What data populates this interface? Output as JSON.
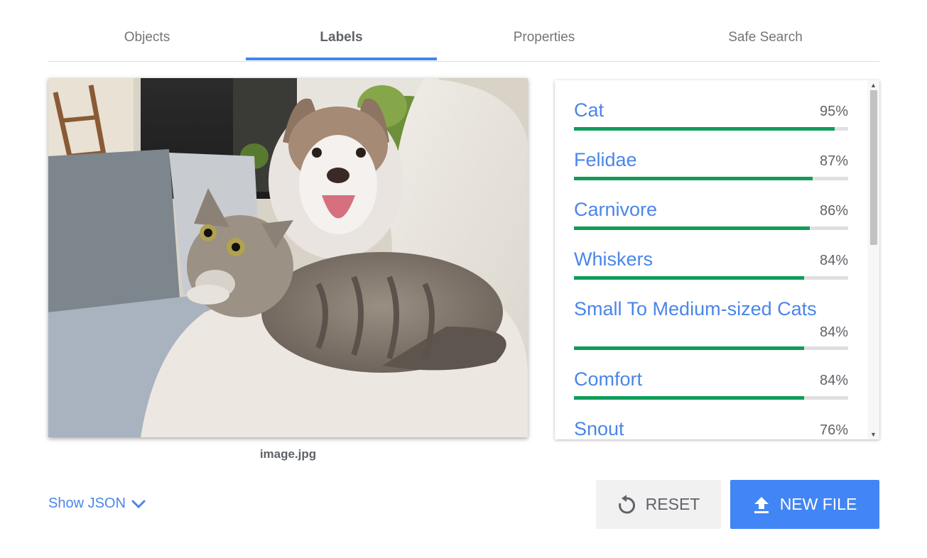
{
  "tabs": [
    {
      "label": "Objects",
      "active": false
    },
    {
      "label": "Labels",
      "active": true
    },
    {
      "label": "Properties",
      "active": false
    },
    {
      "label": "Safe Search",
      "active": false
    }
  ],
  "image": {
    "caption": "image.jpg"
  },
  "labels": [
    {
      "name": "Cat",
      "percent": "95%",
      "score": 0.95
    },
    {
      "name": "Felidae",
      "percent": "87%",
      "score": 0.87
    },
    {
      "name": "Carnivore",
      "percent": "86%",
      "score": 0.86
    },
    {
      "name": "Whiskers",
      "percent": "84%",
      "score": 0.84
    },
    {
      "name": "Small To Medium-sized Cats",
      "percent": "84%",
      "score": 0.84
    },
    {
      "name": "Comfort",
      "percent": "84%",
      "score": 0.84
    },
    {
      "name": "Snout",
      "percent": "76%",
      "score": 0.76
    }
  ],
  "footer": {
    "show_json": "Show JSON",
    "reset": "RESET",
    "new_file": "NEW FILE"
  },
  "colors": {
    "accent": "#4285f4",
    "label_text": "#4a86e8",
    "bar_fill": "#0f9d58",
    "bar_track": "#e0e0e0"
  },
  "icons": {
    "show_json": "chevron-down-icon",
    "reset": "reset-icon",
    "new_file": "upload-icon"
  }
}
